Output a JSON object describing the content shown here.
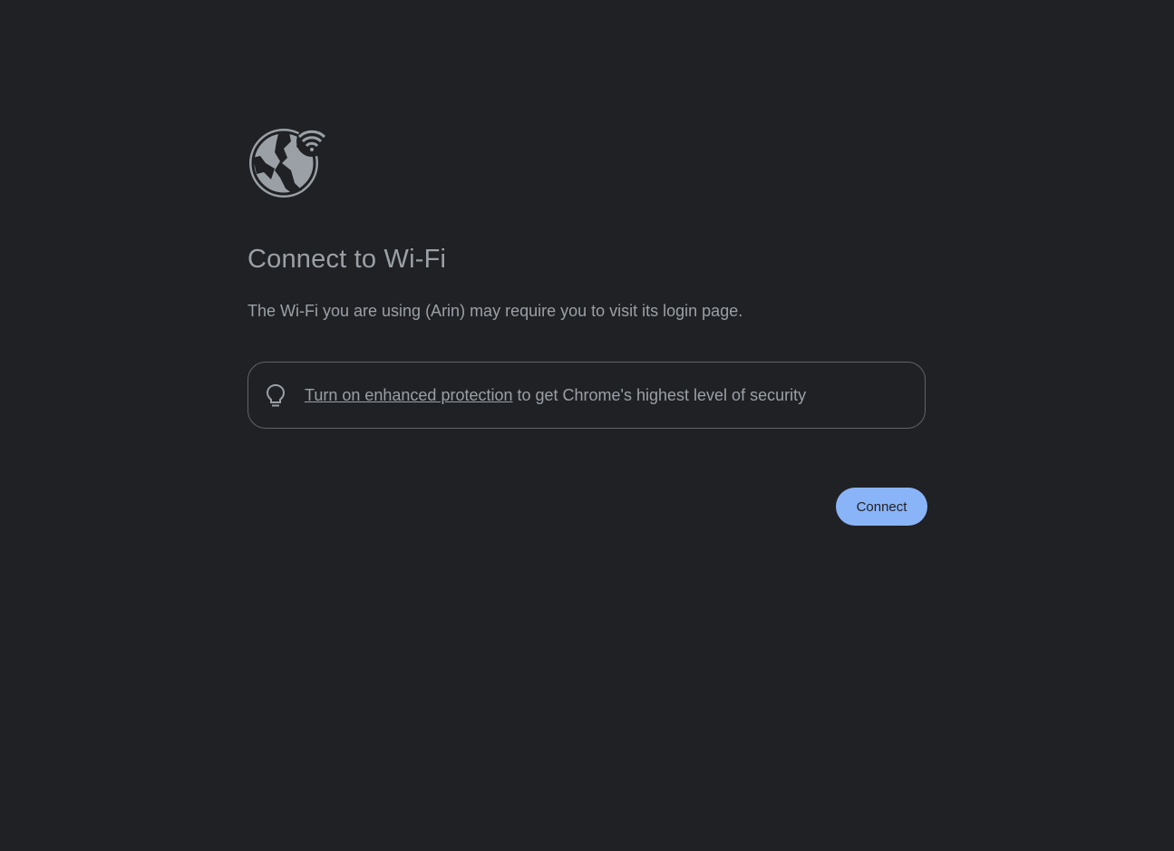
{
  "page": {
    "title": "Connect to Wi-Fi",
    "message": "The Wi-Fi you are using (Arin) may require you to visit its login page."
  },
  "promo": {
    "icon": "lightbulb-icon",
    "link_text": "Turn on enhanced protection",
    "rest_text": " to get Chrome's highest level of security"
  },
  "actions": {
    "connect_label": "Connect"
  },
  "icons": {
    "hero": "globe-wifi-icon"
  },
  "colors": {
    "background": "#202124",
    "text": "#9aa0a6",
    "border": "#5f6368",
    "button": "#8ab4f8",
    "button_text": "#202124"
  }
}
